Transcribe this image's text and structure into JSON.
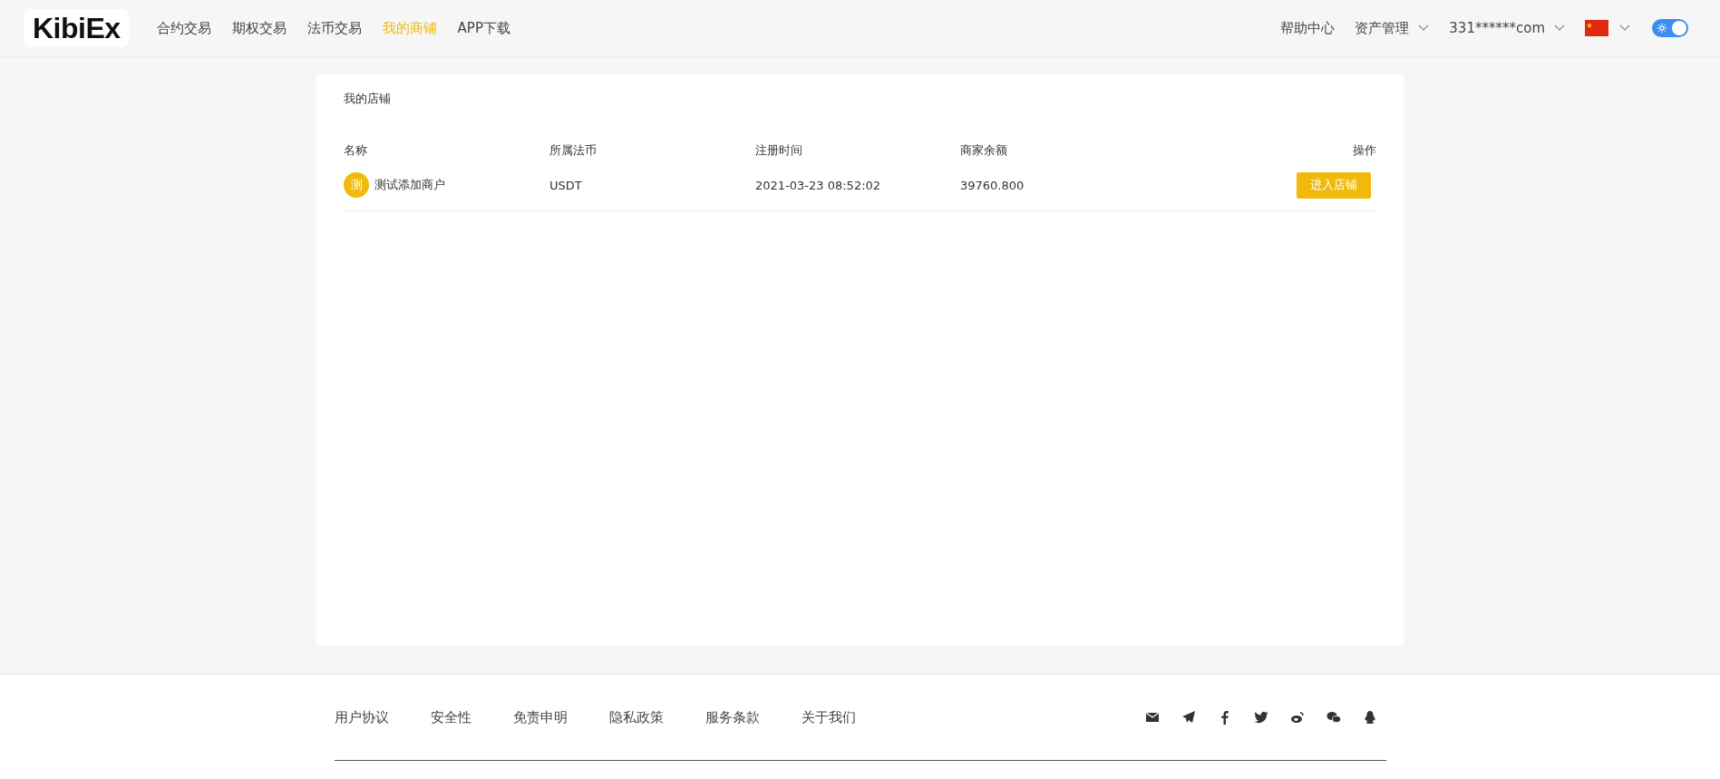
{
  "header": {
    "logo": "KibiEx",
    "nav": [
      {
        "label": "合约交易",
        "selected": false
      },
      {
        "label": "期权交易",
        "selected": false
      },
      {
        "label": "法币交易",
        "selected": false
      },
      {
        "label": "我的商铺",
        "selected": true
      },
      {
        "label": "APP下载",
        "selected": false
      }
    ],
    "help": "帮助中心",
    "assets": "资产管理",
    "account": "331******com",
    "theme_toggle": {
      "on": true
    }
  },
  "card": {
    "title": "我的店铺",
    "table": {
      "columns": [
        "名称",
        "所属法币",
        "注册时间",
        "商家余额",
        "操作"
      ],
      "rows": [
        {
          "avatar": "测",
          "name": "测试添加商户",
          "currency": "USDT",
          "registered": "2021-03-23 08:52:02",
          "balance": "39760.800",
          "action": "进入店铺"
        }
      ]
    }
  },
  "footer": {
    "links": [
      "用户协议",
      "安全性",
      "免责申明",
      "隐私政策",
      "服务条款",
      "关于我们"
    ]
  }
}
